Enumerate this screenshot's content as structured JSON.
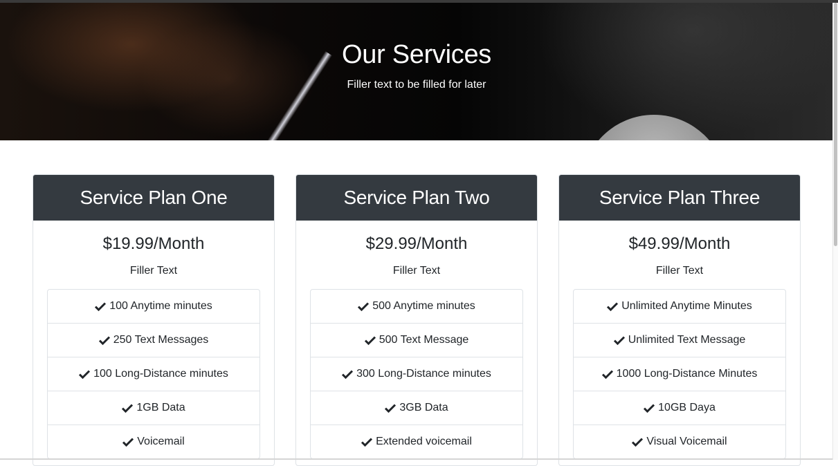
{
  "hero": {
    "title": "Our Services",
    "subtitle": "Filler text to be filled for later"
  },
  "plans": [
    {
      "name": "Service Plan One",
      "price": "$19.99/Month",
      "description": "Filler Text",
      "features": [
        "100 Anytime minutes",
        "250 Text Messages",
        "100 Long-Distance minutes",
        "1GB Data",
        "Voicemail"
      ]
    },
    {
      "name": "Service Plan Two",
      "price": "$29.99/Month",
      "description": "Filler Text",
      "features": [
        "500 Anytime minutes",
        "500 Text Message",
        "300 Long-Distance minutes",
        "3GB Data",
        "Extended voicemail"
      ]
    },
    {
      "name": "Service Plan Three",
      "price": "$49.99/Month",
      "description": "Filler Text",
      "features": [
        "Unlimited Anytime Minutes",
        "Unlimited Text Message",
        "1000 Long-Distance Minutes",
        "10GB Daya",
        "Visual Voicemail"
      ]
    }
  ],
  "icons": {
    "feature": "check-icon"
  },
  "colors": {
    "card_header": "#343a40",
    "hero_text": "#ffffff"
  }
}
